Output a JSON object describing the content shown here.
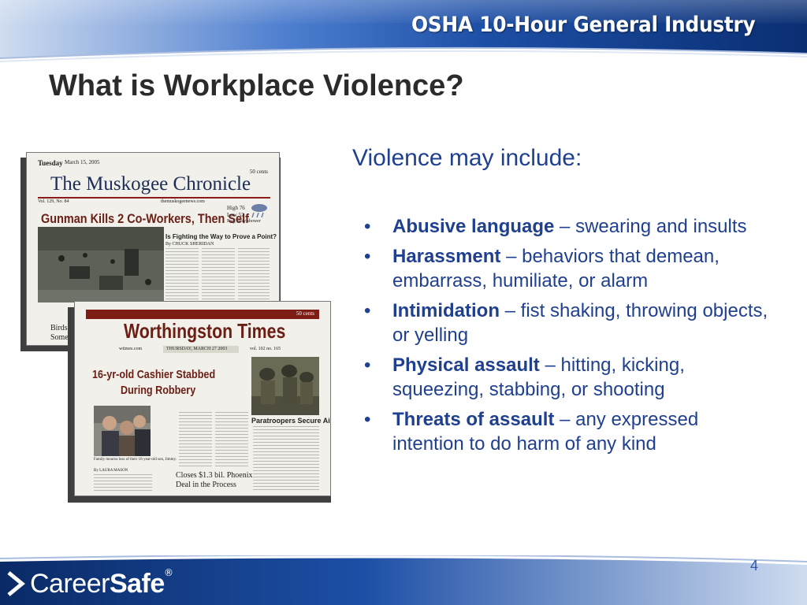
{
  "header": {
    "title": "OSHA 10-Hour General Industry",
    "colors": {
      "dark": "#0b2f73",
      "mid": "#2b5fb8",
      "light": "#dfe7f5"
    }
  },
  "slide": {
    "title": "What is Workplace Violence?",
    "intro": "Violence may include:",
    "bullets": [
      {
        "term": "Abusive language",
        "desc": " – swearing and insults"
      },
      {
        "term": "Harassment",
        "desc": " – behaviors that demean, embarrass, humiliate, or alarm"
      },
      {
        "term": "Intimidation",
        "desc": " – fist shaking, throwing objects, or yelling"
      },
      {
        "term": "Physical assault",
        "desc": " – hitting, kicking, squeezing, stabbing, or shooting"
      },
      {
        "term": "Threats of assault",
        "desc": " – any expressed intention to do harm of any kind"
      }
    ],
    "text_color": "#1f3f8f"
  },
  "newspaper1": {
    "day": "Tuesday",
    "date": "March 15, 2005",
    "price": "50 cents",
    "masthead": "The Muskogee Chronicle",
    "volume": "Vol. 129, No. 84",
    "website": "themuskogeenews.com",
    "headline": "Gunman Kills 2 Co-Workers, Then Self",
    "weather": [
      "High 76",
      "Low 52",
      "Fog, stray shower"
    ],
    "subhead": "Is Fighting the Way to Prove a Point?",
    "byline": "By CHUCK SHERIDAN",
    "teaser": "Birds F",
    "teaser2": "Some A"
  },
  "newspaper2": {
    "price": "50 cents",
    "masthead": "Worthingston Times",
    "website": "wtimes.com",
    "date": "THURSDAY, MARCH 27 2003",
    "volume": "vol. 102 no. 165",
    "headline_line1": "16-yr-old Cashier Stabbed",
    "headline_line2": "During Robbery",
    "photo_caption": "Paratroopers Secure Airfield",
    "caption_small": "Family mourns loss of their 16-year-old son, Jimmy.",
    "byline": "By LAURA MASON",
    "story_teaser_line1": "Closes $1.3 bil. Phoenix",
    "story_teaser_line2": "Deal in the Process"
  },
  "footer": {
    "logo_light": "Career",
    "logo_bold": "Safe",
    "logo_reg": "®",
    "page_number": "4"
  }
}
